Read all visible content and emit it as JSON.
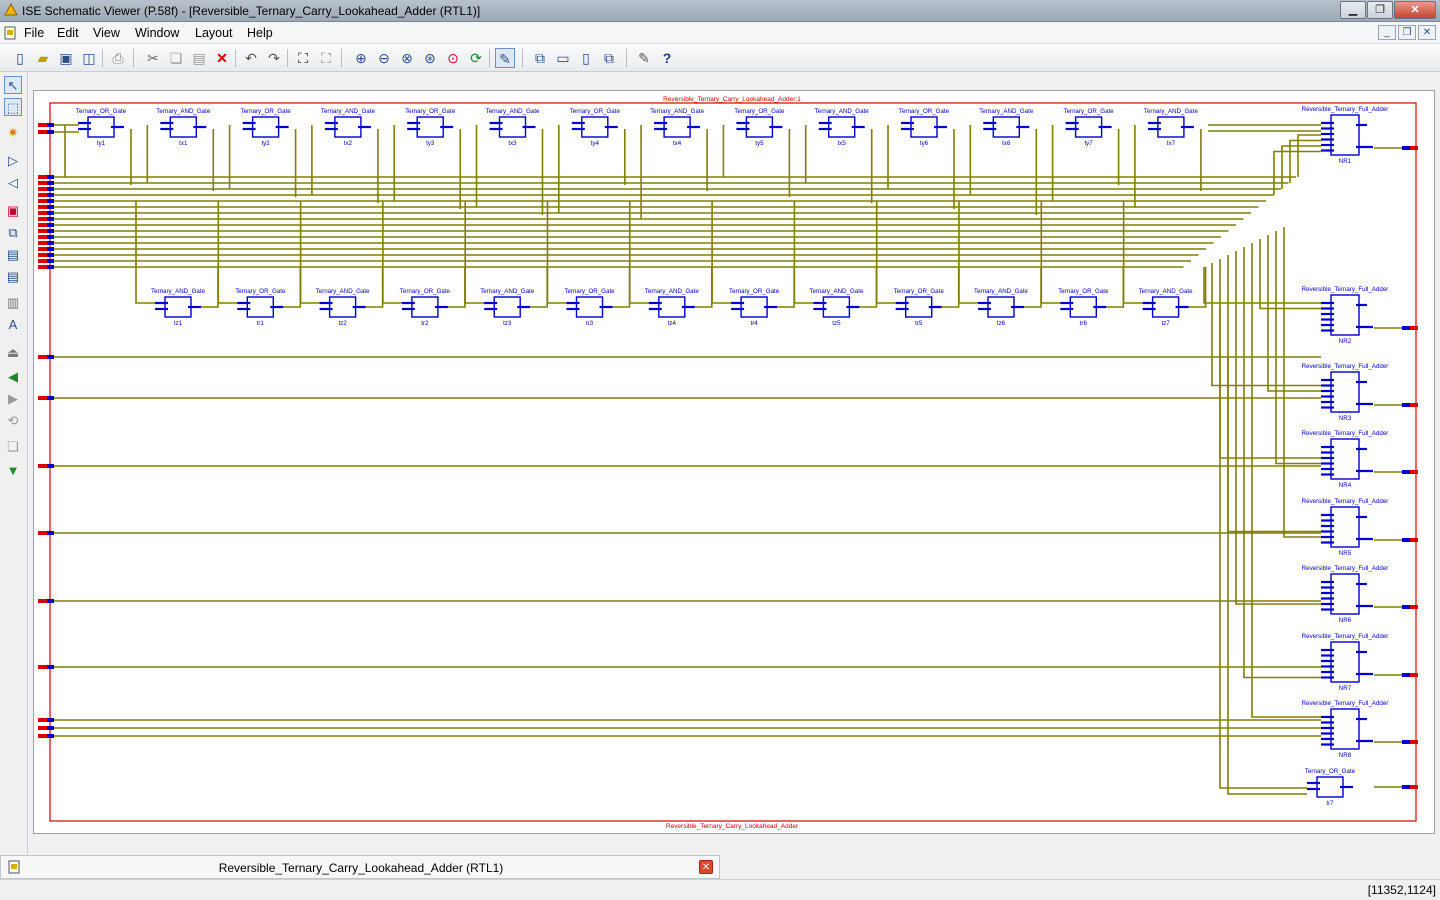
{
  "window": {
    "title": "ISE Schematic Viewer (P.58f) - [Reversible_Ternary_Carry_Lookahead_Adder (RTL1)]"
  },
  "menus": [
    "File",
    "Edit",
    "View",
    "Window",
    "Layout",
    "Help"
  ],
  "schematic": {
    "top_label": "Reversible_Ternary_Carry_Lookahead_Adder:1",
    "bottom_label": "Reversible_Ternary_Carry_Lookahead_Adder",
    "top_row": [
      {
        "type": "Ternary_OR_Gate",
        "name": "ty1"
      },
      {
        "type": "Ternary_AND_Gate",
        "name": "tx1"
      },
      {
        "type": "Ternary_OR_Gate",
        "name": "ty2"
      },
      {
        "type": "Ternary_AND_Gate",
        "name": "tx2"
      },
      {
        "type": "Ternary_OR_Gate",
        "name": "ty3"
      },
      {
        "type": "Ternary_AND_Gate",
        "name": "tx3"
      },
      {
        "type": "Ternary_OR_Gate",
        "name": "ty4"
      },
      {
        "type": "Ternary_AND_Gate",
        "name": "tx4"
      },
      {
        "type": "Ternary_OR_Gate",
        "name": "ty5"
      },
      {
        "type": "Ternary_AND_Gate",
        "name": "tx5"
      },
      {
        "type": "Ternary_OR_Gate",
        "name": "ty6"
      },
      {
        "type": "Ternary_AND_Gate",
        "name": "tx6"
      },
      {
        "type": "Ternary_OR_Gate",
        "name": "ty7"
      },
      {
        "type": "Ternary_AND_Gate",
        "name": "tx7"
      }
    ],
    "second_row": [
      {
        "type": "Ternary_AND_Gate",
        "name": "tz1"
      },
      {
        "type": "Ternary_OR_Gate",
        "name": "tr1"
      },
      {
        "type": "Ternary_AND_Gate",
        "name": "tz2"
      },
      {
        "type": "Ternary_OR_Gate",
        "name": "tr2"
      },
      {
        "type": "Ternary_AND_Gate",
        "name": "tz3"
      },
      {
        "type": "Ternary_OR_Gate",
        "name": "tr3"
      },
      {
        "type": "Ternary_AND_Gate",
        "name": "tz4"
      },
      {
        "type": "Ternary_OR_Gate",
        "name": "tr4"
      },
      {
        "type": "Ternary_AND_Gate",
        "name": "tz5"
      },
      {
        "type": "Ternary_OR_Gate",
        "name": "tr5"
      },
      {
        "type": "Ternary_AND_Gate",
        "name": "tz6"
      },
      {
        "type": "Ternary_OR_Gate",
        "name": "tr6"
      },
      {
        "type": "Ternary_AND_Gate",
        "name": "tz7"
      }
    ],
    "adders": [
      {
        "type": "Reversible_Ternary_Full_Adder",
        "name": "NR1"
      },
      {
        "type": "Reversible_Ternary_Full_Adder",
        "name": "NR2"
      },
      {
        "type": "Reversible_Ternary_Full_Adder",
        "name": "NR3"
      },
      {
        "type": "Reversible_Ternary_Full_Adder",
        "name": "NR4"
      },
      {
        "type": "Reversible_Ternary_Full_Adder",
        "name": "NR5"
      },
      {
        "type": "Reversible_Ternary_Full_Adder",
        "name": "NR6"
      },
      {
        "type": "Reversible_Ternary_Full_Adder",
        "name": "NR7"
      },
      {
        "type": "Reversible_Ternary_Full_Adder",
        "name": "NR8"
      }
    ],
    "final_gate": {
      "type": "Ternary_OR_Gate",
      "name": "tr7"
    },
    "colors": {
      "wire": "#808000",
      "symbol": "#0000cc",
      "port": "#dd0000",
      "border": "#dd0000"
    }
  },
  "bottom_tab": {
    "label": "Reversible_Ternary_Carry_Lookahead_Adder (RTL1)"
  },
  "status": {
    "coords": "[11352,1124]"
  }
}
